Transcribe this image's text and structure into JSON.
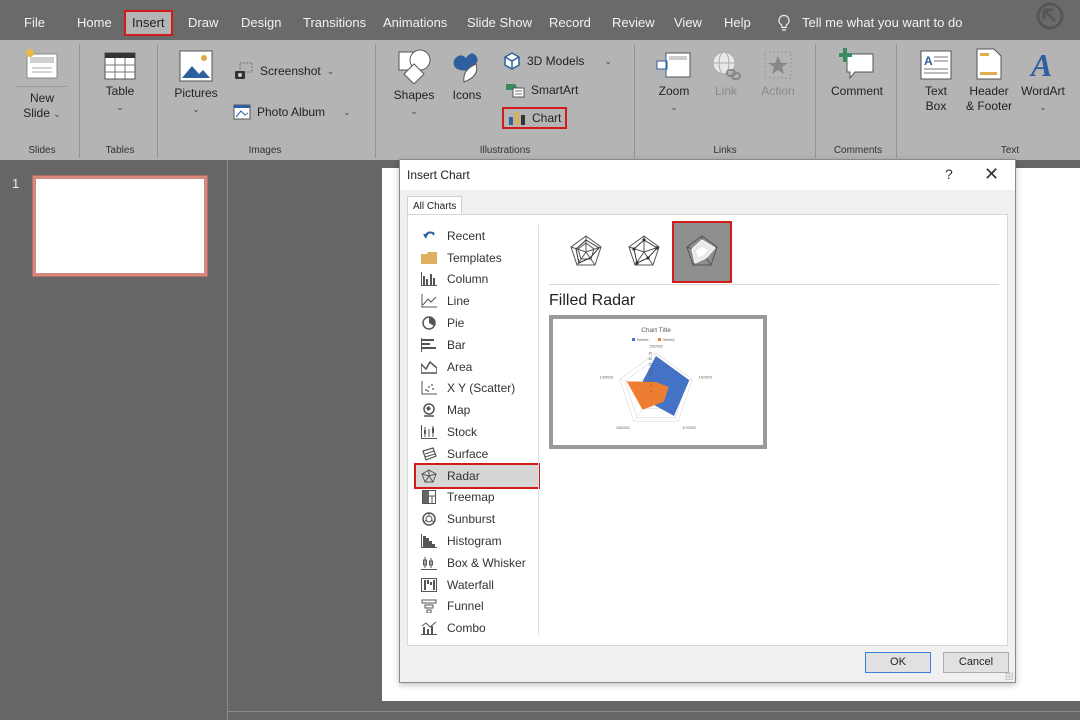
{
  "menu": {
    "tabs": [
      {
        "label": "File"
      },
      {
        "label": "Home"
      },
      {
        "label": "Insert",
        "active": true
      },
      {
        "label": "Draw"
      },
      {
        "label": "Design"
      },
      {
        "label": "Transitions"
      },
      {
        "label": "Animations"
      },
      {
        "label": "Slide Show"
      },
      {
        "label": "Record"
      },
      {
        "label": "Review"
      },
      {
        "label": "View"
      },
      {
        "label": "Help"
      }
    ],
    "tell_me": "Tell me what you want to do"
  },
  "ribbon": {
    "new_slide_line1": "New",
    "new_slide_line2": "Slide",
    "table": "Table",
    "pictures": "Pictures",
    "screenshot": "Screenshot",
    "photo_album": "Photo Album",
    "shapes": "Shapes",
    "icons": "Icons",
    "models_3d": "3D Models",
    "smartart": "SmartArt",
    "chart": "Chart",
    "zoom": "Zoom",
    "link": "Link",
    "action": "Action",
    "comment": "Comment",
    "text_box_line1": "Text",
    "text_box_line2": "Box",
    "header_footer_line1": "Header",
    "header_footer_line2": "& Footer",
    "wordart": "WordArt",
    "groups": {
      "slides": "Slides",
      "tables": "Tables",
      "images": "Images",
      "illustrations": "Illustrations",
      "links": "Links",
      "comments": "Comments",
      "text": "Text"
    }
  },
  "slides_pane": {
    "slide_number": "1"
  },
  "dialog": {
    "title": "Insert Chart",
    "help": "?",
    "close": "✕",
    "tab": "All Charts",
    "categories": [
      {
        "label": "Recent",
        "icon": "recent-icon"
      },
      {
        "label": "Templates",
        "icon": "templates-folder-icon"
      },
      {
        "label": "Column",
        "icon": "column-chart-icon"
      },
      {
        "label": "Line",
        "icon": "line-chart-icon"
      },
      {
        "label": "Pie",
        "icon": "pie-chart-icon"
      },
      {
        "label": "Bar",
        "icon": "bar-chart-icon"
      },
      {
        "label": "Area",
        "icon": "area-chart-icon"
      },
      {
        "label": "X Y (Scatter)",
        "icon": "scatter-chart-icon"
      },
      {
        "label": "Map",
        "icon": "map-chart-icon"
      },
      {
        "label": "Stock",
        "icon": "stock-chart-icon"
      },
      {
        "label": "Surface",
        "icon": "surface-chart-icon"
      },
      {
        "label": "Radar",
        "icon": "radar-chart-icon",
        "selected": true
      },
      {
        "label": "Treemap",
        "icon": "treemap-chart-icon"
      },
      {
        "label": "Sunburst",
        "icon": "sunburst-chart-icon"
      },
      {
        "label": "Histogram",
        "icon": "histogram-chart-icon"
      },
      {
        "label": "Box & Whisker",
        "icon": "box-whisker-chart-icon"
      },
      {
        "label": "Waterfall",
        "icon": "waterfall-chart-icon"
      },
      {
        "label": "Funnel",
        "icon": "funnel-chart-icon"
      },
      {
        "label": "Combo",
        "icon": "combo-chart-icon"
      }
    ],
    "subtypes": [
      "Radar",
      "Radar with Markers",
      "Filled Radar"
    ],
    "selected_subtype_title": "Filled Radar",
    "ok": "OK",
    "cancel": "Cancel"
  },
  "chart_data": {
    "type": "radar",
    "title": "Chart Title",
    "categories": [
      "1/5/2002",
      "1/6/2002",
      "1/7/2002",
      "1/8/2002",
      "1/9/2002"
    ],
    "series": [
      {
        "name": "Series1",
        "color": "#4472c4",
        "values": [
          32,
          32,
          28,
          12,
          15
        ]
      },
      {
        "name": "Series2",
        "color": "#ed7d31",
        "values": [
          8,
          12,
          12,
          21,
          28
        ]
      }
    ],
    "ticks": [
      0,
      5,
      10,
      15,
      20,
      25,
      30,
      35
    ],
    "ylim": [
      0,
      35
    ],
    "legend": "top"
  },
  "colors": {
    "highlight": "#d11a1a",
    "menubar": "#6a6a6a",
    "ribbon": "#b4b4b4"
  }
}
